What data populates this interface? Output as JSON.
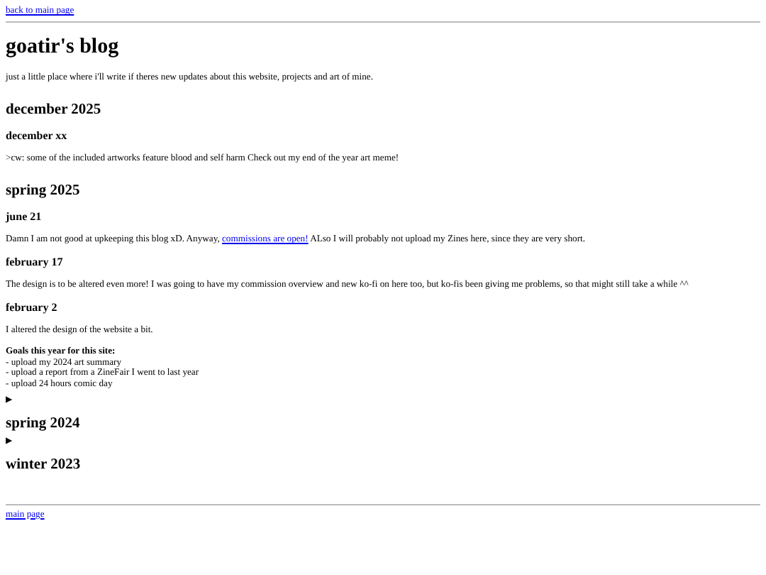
{
  "top_link": "back to main page",
  "title": "goatir's blog",
  "tagline": "just a little place where i'll write if theres new updates about this website, projects and art of mine.",
  "blocks": [
    {
      "kind": "season",
      "text": "december 2025"
    },
    {
      "kind": "date",
      "text": "december xx"
    },
    {
      "kind": "text",
      "parts": [
        {
          "text": ">cw: some of the included artworks feature blood and self harm Check out my end of the year art meme!"
        }
      ]
    },
    {
      "kind": "season",
      "text": "spring 2025"
    },
    {
      "kind": "date",
      "text": "june 21"
    },
    {
      "kind": "text",
      "parts": [
        {
          "text": "Damn I am not good at upkeeping this blog xD. Anyway, "
        },
        {
          "text": "commissions are open!",
          "link": true
        },
        {
          "text": " ALso I will probably not upload my Zines here, since they are very short."
        }
      ]
    },
    {
      "kind": "date",
      "text": "february 17"
    },
    {
      "kind": "text",
      "parts": [
        {
          "text": "The design is to be altered even more! I was going to have my commission overview and new ko-fi on here too, but ko-fis been giving me problems, so that might still take a while ^^"
        }
      ]
    },
    {
      "kind": "date",
      "text": "february 2"
    },
    {
      "kind": "text",
      "parts": [
        {
          "text": "I altered the design of the website a bit."
        }
      ]
    },
    {
      "kind": "goals",
      "heading": "Goals this year for this site:",
      "items": [
        "- upload my 2024 art summary",
        "- upload a report from a ZineFair I went to last year",
        "- upload 24 hours comic day"
      ]
    },
    {
      "kind": "toggle",
      "text": "▶",
      "expanded": false
    },
    {
      "kind": "season",
      "text": "spring 2024"
    },
    {
      "kind": "toggle",
      "text": "▶",
      "expanded": false
    },
    {
      "kind": "season",
      "text": "winter 2023"
    }
  ],
  "bottom_link": "main page"
}
